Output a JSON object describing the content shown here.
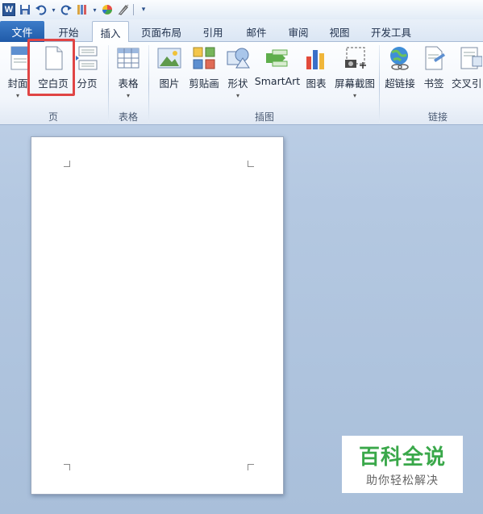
{
  "quick_access": {
    "app_icon_letter": "W",
    "items": [
      "save-icon",
      "undo-icon",
      "redo-icon",
      "format-painter-icon",
      "color-icon",
      "clear-icon",
      "customize-icon"
    ]
  },
  "tabs": {
    "file": "文件",
    "items": [
      "开始",
      "插入",
      "页面布局",
      "引用",
      "邮件",
      "审阅",
      "视图",
      "开发工具"
    ],
    "active": "插入"
  },
  "ribbon": {
    "buttons": {
      "cover": "封面",
      "blank_page": "空白页",
      "page_break": "分页",
      "table": "表格",
      "picture": "图片",
      "clipart": "剪贴画",
      "shapes": "形状",
      "smartart": "SmartArt",
      "chart": "图表",
      "screenshot": "屏幕截图",
      "hyperlink": "超链接",
      "bookmark": "书签",
      "cross_reference": "交叉引"
    },
    "groups": {
      "pages": "页",
      "tables": "表格",
      "illustrations": "插图",
      "links": "链接"
    }
  },
  "watermark": {
    "title": "百科全说",
    "subtitle": "助你轻松解决"
  },
  "colors": {
    "file_tab": "#2a65b3",
    "highlight": "#e04545",
    "watermark_green": "#3aa84a"
  }
}
